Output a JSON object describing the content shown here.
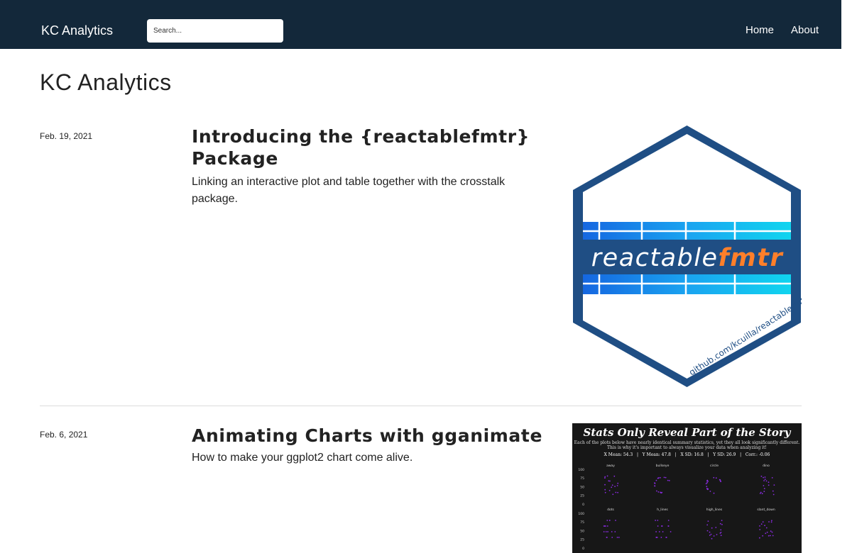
{
  "nav": {
    "brand": "KC Analytics",
    "search_placeholder": "Search...",
    "links": [
      "Home",
      "About"
    ]
  },
  "page": {
    "title": "KC Analytics"
  },
  "posts": [
    {
      "date": "Feb. 19, 2021",
      "title": "Introducing the {reactablefmtr} Package",
      "description": "Linking an interactive plot and table together with the crosstalk package.",
      "image": {
        "logo_prefix": "reactable",
        "logo_suffix": "fmtr",
        "url_text": "github.com/kcuilla/reactablefmtr"
      }
    },
    {
      "date": "Feb. 6, 2021",
      "title": "Animating Charts with gganimate",
      "description": "How to make your ggplot2 chart come alive.",
      "image": {
        "title": "Stats Only Reveal Part of the Story",
        "subtitle_1": "Each of the plots below have nearly identical summary statistics, yet they all look significantly different.",
        "subtitle_2": "This is why it's important to always visualize your data when analyzing it!",
        "stats_line": "X Mean: 54.3   |   Y Mean: 47.8   |   X SD: 16.8   |   Y SD: 26.9   |   Corr.: -0.06",
        "panel_names": [
          "away",
          "bullseye",
          "circle",
          "dino",
          "dots",
          "h_lines",
          "high_lines",
          "slant_down"
        ],
        "y_ticks": [
          "100",
          "75",
          "50",
          "25",
          "0"
        ]
      }
    }
  ]
}
